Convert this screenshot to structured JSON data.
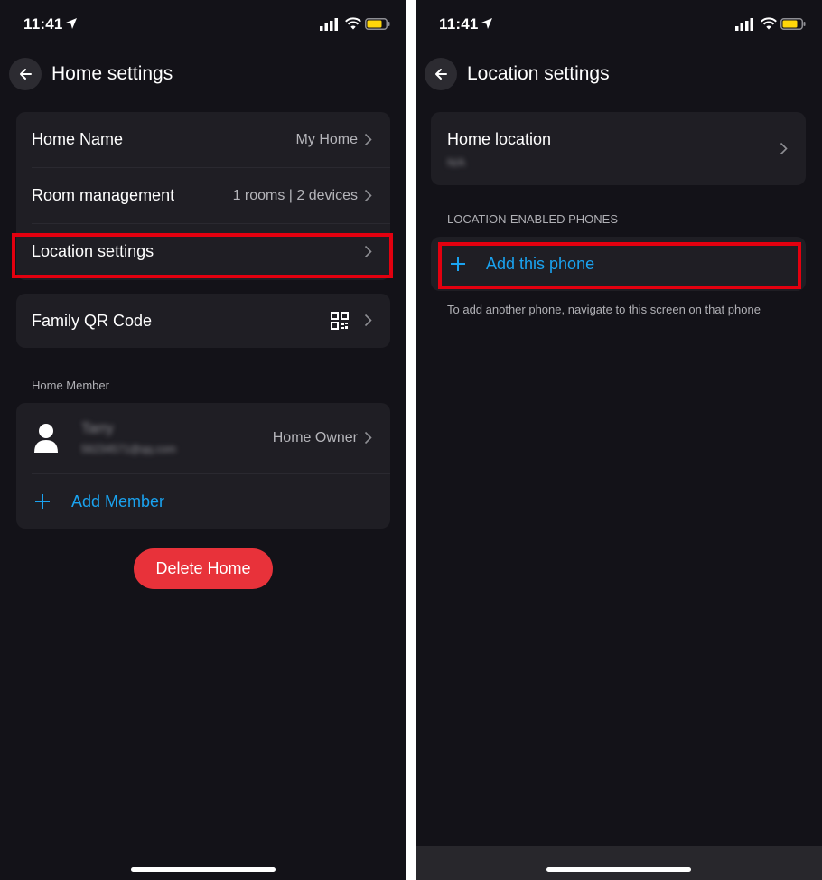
{
  "status_bar": {
    "time": "11:41"
  },
  "left": {
    "nav_title": "Home settings",
    "rows": [
      {
        "label": "Home Name",
        "value": "My Home"
      },
      {
        "label": "Room management",
        "value": "1 rooms | 2 devices"
      },
      {
        "label": "Location settings",
        "value": ""
      }
    ],
    "family_qr_label": "Family QR Code",
    "member_section_label": "Home Member",
    "member": {
      "name": "Tarry",
      "email": "56234571@qq.com",
      "role": "Home Owner"
    },
    "add_member_label": "Add Member",
    "delete_label": "Delete Home"
  },
  "right": {
    "nav_title": "Location settings",
    "home_location_label": "Home location",
    "home_location_value": "N/A",
    "phones_section_label": "LOCATION-ENABLED PHONES",
    "add_phone_label": "Add this phone",
    "hint_text": "To add another phone, navigate to this screen on that phone"
  },
  "colors": {
    "accent": "#1aa3f0",
    "danger": "#e8323a",
    "highlight": "#e3000f",
    "background": "#131218",
    "card": "#1f1e24"
  }
}
